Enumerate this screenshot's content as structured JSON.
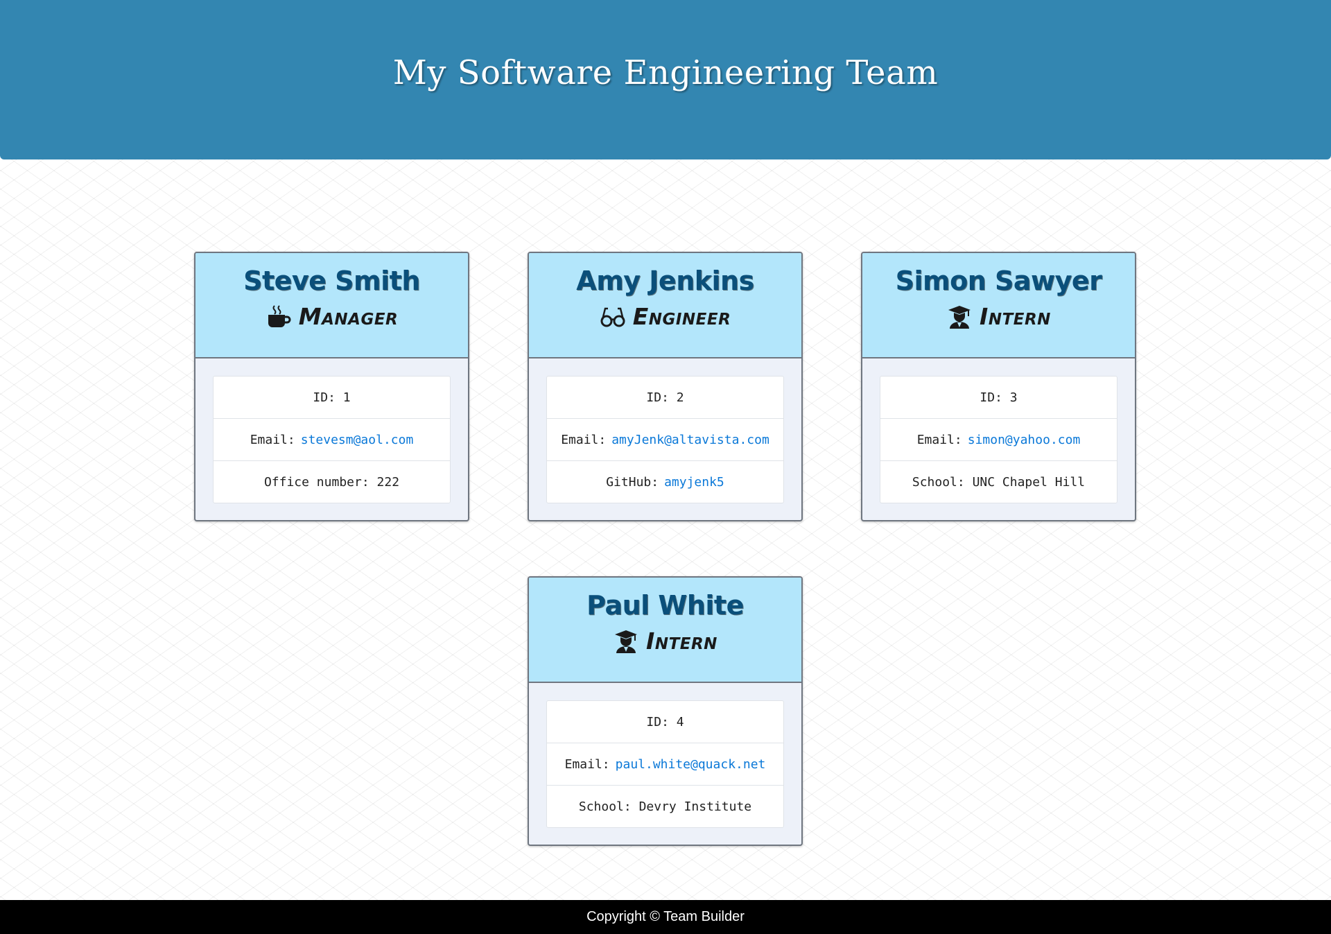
{
  "header": {
    "title": "My Software Engineering Team"
  },
  "cards": [
    {
      "name": "Steve Smith",
      "role": "Manager",
      "icon": "coffee-mug-icon",
      "id_label": "ID:",
      "id_value": "1",
      "email_label": "Email:",
      "email_value": "stevesm@aol.com",
      "extra_label": "Office number:",
      "extra_value": "222"
    },
    {
      "name": "Amy Jenkins",
      "role": "Engineer",
      "icon": "glasses-icon",
      "id_label": "ID:",
      "id_value": "2",
      "email_label": "Email:",
      "email_value": "amyJenk@altavista.com",
      "extra_label": "GitHub:",
      "extra_value": "amyjenk5"
    },
    {
      "name": "Simon Sawyer",
      "role": "Intern",
      "icon": "graduate-icon",
      "id_label": "ID:",
      "id_value": "3",
      "email_label": "Email:",
      "email_value": "simon@yahoo.com",
      "extra_label": "School:",
      "extra_value": "UNC Chapel Hill"
    },
    {
      "name": "Paul White",
      "role": "Intern",
      "icon": "graduate-icon",
      "id_label": "ID:",
      "id_value": "4",
      "email_label": "Email:",
      "email_value": "paul.white@quack.net",
      "extra_label": "School:",
      "extra_value": "Devry Institute"
    }
  ],
  "footer": {
    "text": "Copyright © Team Builder"
  },
  "colors": {
    "header_bg": "#3386b1",
    "card_head_bg": "#b3e6fb",
    "name_color": "#0a4f7a",
    "link_color": "#0a78d8"
  }
}
